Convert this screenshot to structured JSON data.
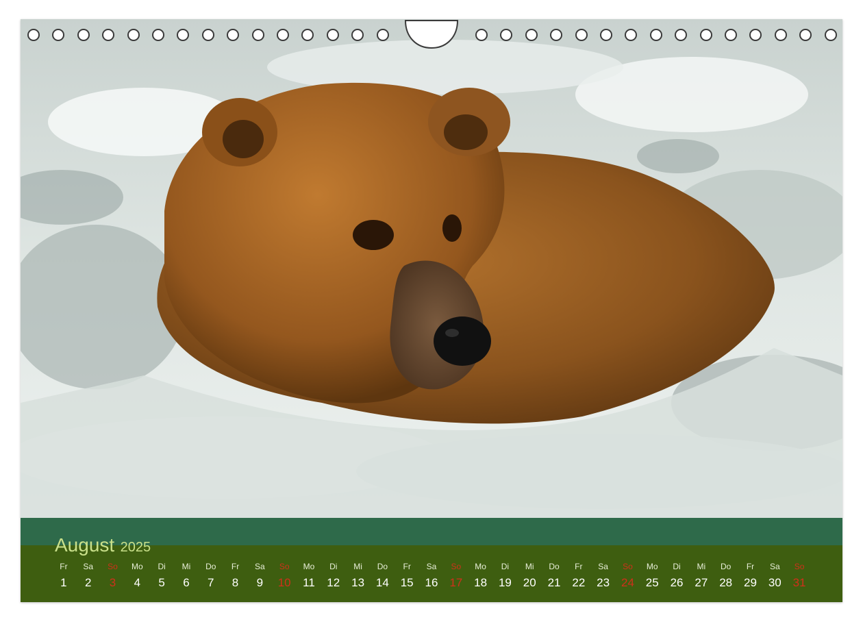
{
  "calendar": {
    "month": "August",
    "year": "2025",
    "sunday_color": "#d0301a",
    "band_colors": {
      "upper": "#2e6a4a",
      "lower": "#3e5e10"
    },
    "days": [
      {
        "dow": "Fr",
        "num": "1"
      },
      {
        "dow": "Sa",
        "num": "2"
      },
      {
        "dow": "So",
        "num": "3"
      },
      {
        "dow": "Mo",
        "num": "4"
      },
      {
        "dow": "Di",
        "num": "5"
      },
      {
        "dow": "Mi",
        "num": "6"
      },
      {
        "dow": "Do",
        "num": "7"
      },
      {
        "dow": "Fr",
        "num": "8"
      },
      {
        "dow": "Sa",
        "num": "9"
      },
      {
        "dow": "So",
        "num": "10"
      },
      {
        "dow": "Mo",
        "num": "11"
      },
      {
        "dow": "Di",
        "num": "12"
      },
      {
        "dow": "Mi",
        "num": "13"
      },
      {
        "dow": "Do",
        "num": "14"
      },
      {
        "dow": "Fr",
        "num": "15"
      },
      {
        "dow": "Sa",
        "num": "16"
      },
      {
        "dow": "So",
        "num": "17"
      },
      {
        "dow": "Mo",
        "num": "18"
      },
      {
        "dow": "Di",
        "num": "19"
      },
      {
        "dow": "Mi",
        "num": "20"
      },
      {
        "dow": "Do",
        "num": "21"
      },
      {
        "dow": "Fr",
        "num": "22"
      },
      {
        "dow": "Sa",
        "num": "23"
      },
      {
        "dow": "So",
        "num": "24"
      },
      {
        "dow": "Mo",
        "num": "25"
      },
      {
        "dow": "Di",
        "num": "26"
      },
      {
        "dow": "Mi",
        "num": "27"
      },
      {
        "dow": "Do",
        "num": "28"
      },
      {
        "dow": "Fr",
        "num": "29"
      },
      {
        "dow": "Sa",
        "num": "30"
      },
      {
        "dow": "So",
        "num": "31"
      }
    ]
  }
}
